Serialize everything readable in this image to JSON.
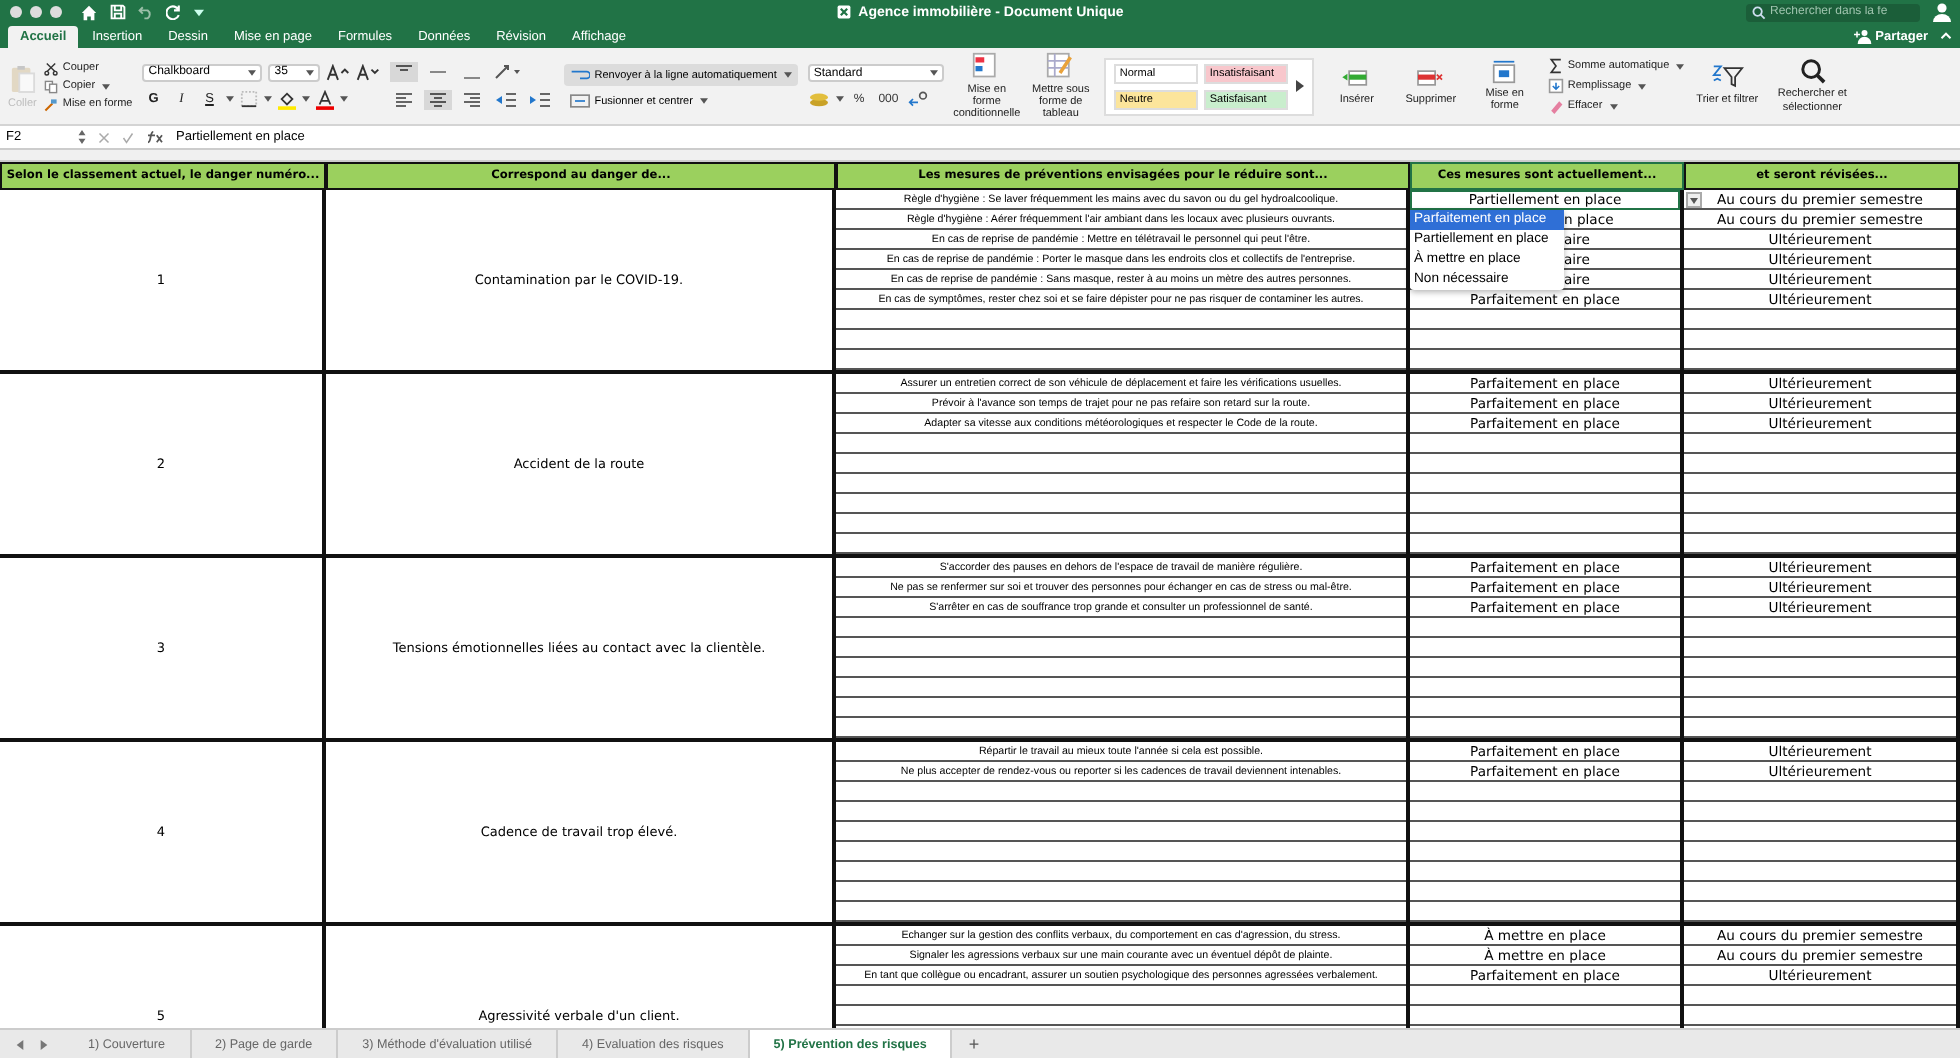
{
  "window": {
    "title": "Agence immobilière - Document Unique",
    "search_placeholder": "Rechercher dans la fe"
  },
  "ribbon_tabs": [
    {
      "label": "Accueil",
      "selected": true
    },
    {
      "label": "Insertion",
      "selected": false
    },
    {
      "label": "Dessin",
      "selected": false
    },
    {
      "label": "Mise en page",
      "selected": false
    },
    {
      "label": "Formules",
      "selected": false
    },
    {
      "label": "Données",
      "selected": false
    },
    {
      "label": "Révision",
      "selected": false
    },
    {
      "label": "Affichage",
      "selected": false
    }
  ],
  "share": "Partager",
  "ribbon": {
    "paste": {
      "label": "Coller",
      "disabled": true
    },
    "clipboard": [
      "Couper",
      "Copier",
      "Mise en forme"
    ],
    "font": {
      "family": "Chalkboard",
      "size": "35"
    },
    "font_style": [
      "G",
      "I",
      "S"
    ],
    "wrap": "Renvoyer à la ligne automatiquement",
    "merge": "Fusionner et centrer",
    "number_format": "Standard",
    "number_buttons": [
      "%",
      "000"
    ],
    "format_buttons": [
      "Mise en forme conditionnelle",
      "Mettre sous forme de tableau"
    ],
    "styles": [
      {
        "label": "Normal",
        "color": "#ffffff"
      },
      {
        "label": "Insatisfaisant",
        "color": "#f8c7cc"
      },
      {
        "label": "Neutre",
        "color": "#fce59b"
      },
      {
        "label": "Satisfaisant",
        "color": "#c9eecd"
      }
    ],
    "cells": [
      "Insérer",
      "Supprimer",
      "Mise en forme"
    ],
    "editing": [
      "Somme automatique",
      "Remplissage",
      "Effacer"
    ],
    "sort": "Trier et filtrer",
    "find": "Rechercher et sélectionner"
  },
  "formula_bar": {
    "cell": "F2",
    "value": "Partiellement en place"
  },
  "table": {
    "columns": [
      "Selon le classement actuel, le danger numéro...",
      "Correspond au danger de...",
      "Les mesures de préventions envisagées pour le réduire sont...",
      "Ces mesures sont actuellement...",
      "et seront révisées..."
    ],
    "groups": [
      {
        "number": "1",
        "danger": "Contamination par le COVID-19.",
        "measures": [
          {
            "text": "Règle d'hygiène : Se laver fréquemment les mains avec du savon ou du gel hydroalcoolique.",
            "status": "Partiellement en place",
            "status_clipped": false,
            "review": "Au cours du premier semestre",
            "selected": true
          },
          {
            "text": "Règle d'hygiène : Aérer fréquemment l'air ambiant dans les locaux avec plusieurs ouvrants.",
            "status": "n place",
            "status_clipped": true,
            "review": "Au cours du premier semestre",
            "selected": false
          },
          {
            "text": "En cas de reprise de pandémie : Mettre en télétravail le personnel qui peut l'être.",
            "status": "aire",
            "status_clipped": true,
            "review": "Ultérieurement",
            "selected": false
          },
          {
            "text": "En cas de reprise de pandémie : Porter le masque dans les endroits clos et collectifs de l'entreprise.",
            "status": "aire",
            "status_clipped": true,
            "review": "Ultérieurement",
            "selected": false
          },
          {
            "text": "En cas de reprise de pandémie : Sans masque, rester à au moins un mètre des autres personnes.",
            "status": "aire",
            "status_clipped": true,
            "review": "Ultérieurement",
            "selected": false
          },
          {
            "text": "En cas de symptômes, rester chez soi et se faire dépister pour ne pas risquer de contaminer les autres.",
            "status": "Parfaitement en place",
            "status_clipped": false,
            "review": "Ultérieurement",
            "selected": false
          }
        ]
      },
      {
        "number": "2",
        "danger": "Accident de la route",
        "measures": [
          {
            "text": "Assurer un entretien correct de son véhicule de déplacement et faire les vérifications usuelles.",
            "status": "Parfaitement en place",
            "status_clipped": false,
            "review": "Ultérieurement",
            "selected": false
          },
          {
            "text": "Prévoir à l'avance son temps de trajet pour ne pas refaire son retard sur la route.",
            "status": "Parfaitement en place",
            "status_clipped": false,
            "review": "Ultérieurement",
            "selected": false
          },
          {
            "text": "Adapter sa vitesse aux conditions météorologiques et respecter le Code de la route.",
            "status": "Parfaitement en place",
            "status_clipped": false,
            "review": "Ultérieurement",
            "selected": false
          }
        ]
      },
      {
        "number": "3",
        "danger": "Tensions émotionnelles liées au contact avec la clientèle.",
        "measures": [
          {
            "text": "S'accorder des pauses en dehors de l'espace de travail de manière régulière.",
            "status": "Parfaitement en place",
            "status_clipped": false,
            "review": "Ultérieurement",
            "selected": false
          },
          {
            "text": "Ne pas se renfermer sur soi et trouver des personnes pour échanger en cas de stress ou mal-être.",
            "status": "Parfaitement en place",
            "status_clipped": false,
            "review": "Ultérieurement",
            "selected": false
          },
          {
            "text": "S'arrêter en cas de souffrance trop grande et consulter un professionnel de santé.",
            "status": "Parfaitement en place",
            "status_clipped": false,
            "review": "Ultérieurement",
            "selected": false
          }
        ]
      },
      {
        "number": "4",
        "danger": "Cadence de travail trop élevé.",
        "measures": [
          {
            "text": "Répartir le travail au mieux toute l'année si cela est possible.",
            "status": "Parfaitement en place",
            "status_clipped": false,
            "review": "Ultérieurement",
            "selected": false
          },
          {
            "text": "Ne plus accepter de rendez-vous ou reporter si les cadences de travail deviennent intenables.",
            "status": "Parfaitement en place",
            "status_clipped": false,
            "review": "Ultérieurement",
            "selected": false
          }
        ]
      },
      {
        "number": "5",
        "danger": "Agressivité verbale d'un client.",
        "measures": [
          {
            "text": "Echanger sur la gestion des conflits verbaux, du comportement en cas d'agression, du stress.",
            "status": "À mettre en place",
            "status_clipped": false,
            "review": "Au cours du premier semestre",
            "selected": false
          },
          {
            "text": "Signaler les agressions verbaux sur une main courante avec un éventuel dépôt de plainte.",
            "status": "À mettre en place",
            "status_clipped": false,
            "review": "Au cours du premier semestre",
            "selected": false
          },
          {
            "text": "En tant que collègue ou encadrant, assurer un soutien psychologique des personnes agressées verbalement.",
            "status": "Parfaitement en place",
            "status_clipped": false,
            "review": "Ultérieurement",
            "selected": false
          }
        ]
      }
    ]
  },
  "dropdown": {
    "options": [
      {
        "label": "Parfaitement en place",
        "selected": true
      },
      {
        "label": "Partiellement en place",
        "selected": false
      },
      {
        "label": "À mettre en place",
        "selected": false
      },
      {
        "label": "Non nécessaire",
        "selected": false
      }
    ]
  },
  "sheet_tabs": [
    {
      "label": "1) Couverture",
      "selected": false
    },
    {
      "label": "2) Page de garde",
      "selected": false
    },
    {
      "label": "3) Méthode d'évaluation utilisé",
      "selected": false
    },
    {
      "label": "4) Evaluation des risques",
      "selected": false
    },
    {
      "label": "5) Prévention des risques",
      "selected": true
    }
  ],
  "add_sheet": "+"
}
